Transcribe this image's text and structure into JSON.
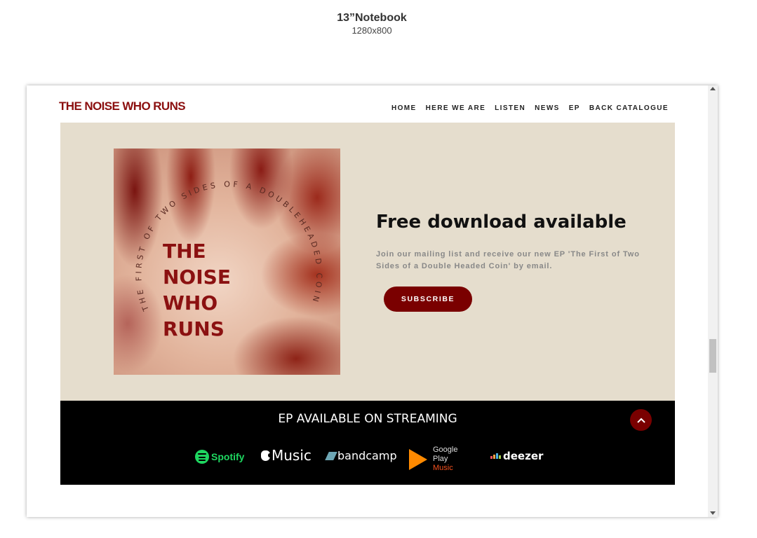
{
  "device": {
    "title": "13”Notebook",
    "resolution": "1280x800"
  },
  "header": {
    "logo": "THE NOISE WHO RUNS",
    "nav": [
      "HOME",
      "HERE WE ARE",
      "LISTEN",
      "NEWS",
      "EP",
      "BACK CATALOGUE"
    ]
  },
  "hero": {
    "cover_title_lines": [
      "THE",
      "NOISE",
      "WHO",
      "RUNS"
    ],
    "cover_arc_text": "THE FIRST OF TWO SIDES OF A DOUBLEHEADED COIN",
    "heading": "Free download available",
    "text": "Join our mailing list and receive our new EP 'The First of Two Sides of a Double Headed Coin' by email.",
    "subscribe_label": "SUBSCRIBE"
  },
  "streaming": {
    "heading": "EP AVAILABLE ON STREAMING",
    "platforms": {
      "spotify": "Spotify",
      "apple": "Music",
      "bandcamp": "bandcamp",
      "google_play_line1": "Google Play",
      "google_play_line2": "Music",
      "deezer": "deezer"
    }
  },
  "colors": {
    "accent": "#7a0000",
    "hero_bg": "#e5ddcd",
    "logo": "#8b0f0f",
    "spotify": "#1ed760"
  }
}
